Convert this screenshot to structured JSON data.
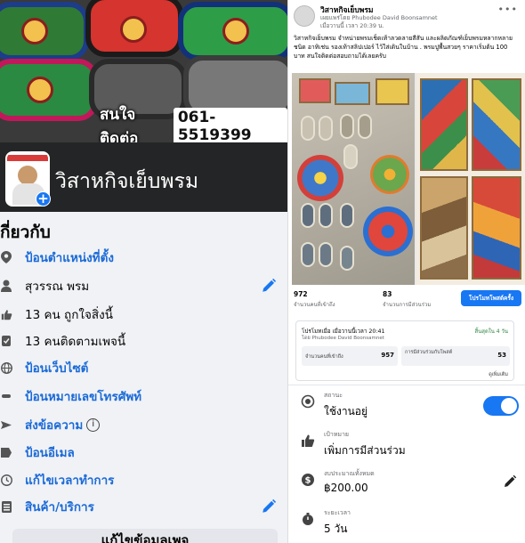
{
  "left": {
    "cover": {
      "contact_label": "สนใจติดต่อ",
      "contact_phone": "061-5519399"
    },
    "profile": {
      "page_name": "วิสาหกิจเย็บพรม"
    },
    "about": {
      "title": "กี่ยวกับ",
      "rows": [
        {
          "icon": "location-pin-icon",
          "text": "ป้อนตำแหน่งที่ตั้ง",
          "link": true
        },
        {
          "icon": "person-icon",
          "text": "สุวรรณ พรม",
          "link": false,
          "editable": true
        },
        {
          "icon": "like-icon",
          "text": "13 คน ถูกใจสิ่งนี้",
          "link": false
        },
        {
          "icon": "follow-icon",
          "text": "13 คนติดตามเพจนี้",
          "link": false
        },
        {
          "icon": "globe-icon",
          "text": "ป้อนเว็บไซต์",
          "link": true
        },
        {
          "icon": "phone-icon",
          "text": "ป้อนหมายเลขโทรศัพท์",
          "link": true
        },
        {
          "icon": "messenger-icon",
          "text": "ส่งข้อความ",
          "link": true,
          "info": true
        },
        {
          "icon": "email-icon",
          "text": "ป้อนอีเมล",
          "link": true
        },
        {
          "icon": "clock-icon",
          "text": "แก้ไขเวลาทำการ",
          "link": true
        },
        {
          "icon": "shop-icon",
          "text": "สินค้า/บริการ",
          "link": true,
          "editable": true
        }
      ],
      "edit_button_label": "แก้ไขข้อมูลเพจ"
    }
  },
  "right": {
    "post": {
      "page_name": "วิสาหกิจเย็บพรม",
      "author_line": "เผยแพร่โดย Phubodee David Boonsamnet",
      "time": "เมื่อวานนี้ เวลา 20:39 น.",
      "text": "วิสาหกิจเย็บพรม จำหน่ายพรมเช็ดเท้าลวดลายสีสัน และผลิตภัณฑ์เย็บพรมหลากหลายชนิด อาทิเช่น รองเท้าสลิปเปอร์ ไว้ใส่เดินในบ้าน . พรมปูพื้นสวยๆ ราคาเริ่มต้น 100 บาท สนใจติดต่อสอบถามได้เลยครับ"
    },
    "stats": {
      "reached_value": "972",
      "reached_label": "จำนวนคนที่เข้าถึง",
      "engagement_value": "83",
      "engagement_label": "จำนวนการมีส่วนร่วม",
      "boost_label": "โปรโมทโพสต์ครั้ง"
    },
    "boost_card": {
      "title": "โปรโมทเมื่อ เมื่อวานนี้เวลา 20:41",
      "by": "โดย Phubodee David Boonsamnet",
      "status": "สิ้นสุดใน 4 วัน",
      "reached_label": "จำนวนคนที่เข้าถึง",
      "reached_value": "957",
      "engagement_label": "การมีส่วนร่วมกับโพสต์",
      "engagement_value": "53",
      "more_label": "ดูเพิ่มเติม"
    },
    "settings": {
      "status_label": "สถานะ",
      "status_value": "ใช้งานอยู่",
      "goal_label": "เป้าหมาย",
      "goal_value": "เพิ่มการมีส่วนร่วม",
      "budget_label": "งบประมาณทั้งหมด",
      "budget_value": "฿200.00",
      "duration_label": "ระยะเวลา",
      "duration_value": "5 วัน"
    }
  },
  "colors": {
    "brand_blue": "#1877f2",
    "link_blue": "#1b6ad8",
    "dark_bar": "#242526"
  }
}
